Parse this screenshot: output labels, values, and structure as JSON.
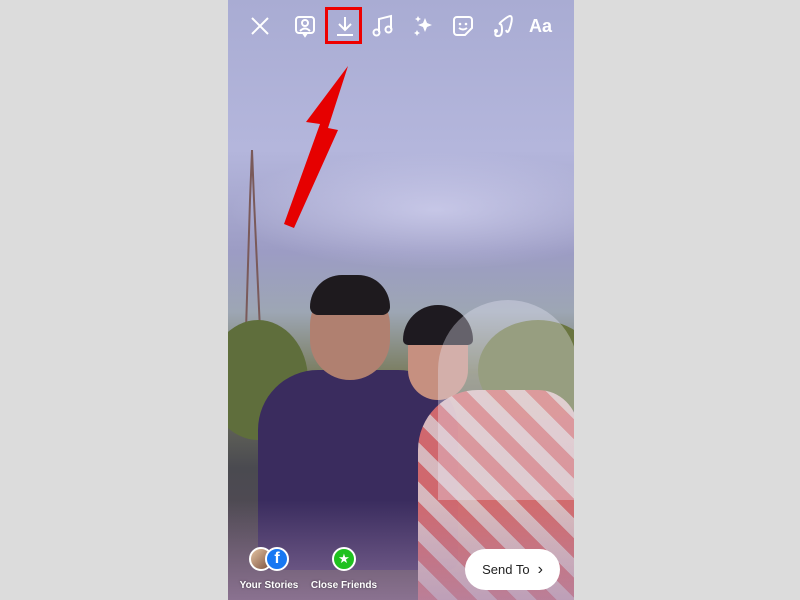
{
  "toolbar": {
    "icons": [
      "close-icon",
      "profile-card-icon",
      "download-icon",
      "music-icon",
      "sparkles-icon",
      "sticker-icon",
      "draw-icon",
      "text-icon"
    ],
    "text_label": "Aa"
  },
  "annotation": {
    "highlight_color": "#e00000",
    "arrow_color": "#e00000"
  },
  "bottom": {
    "your_stories": "Your Stories",
    "close_friends": "Close Friends",
    "send_to": "Send To",
    "close_friends_color": "#1fc11f",
    "facebook_color": "#1877f2"
  }
}
